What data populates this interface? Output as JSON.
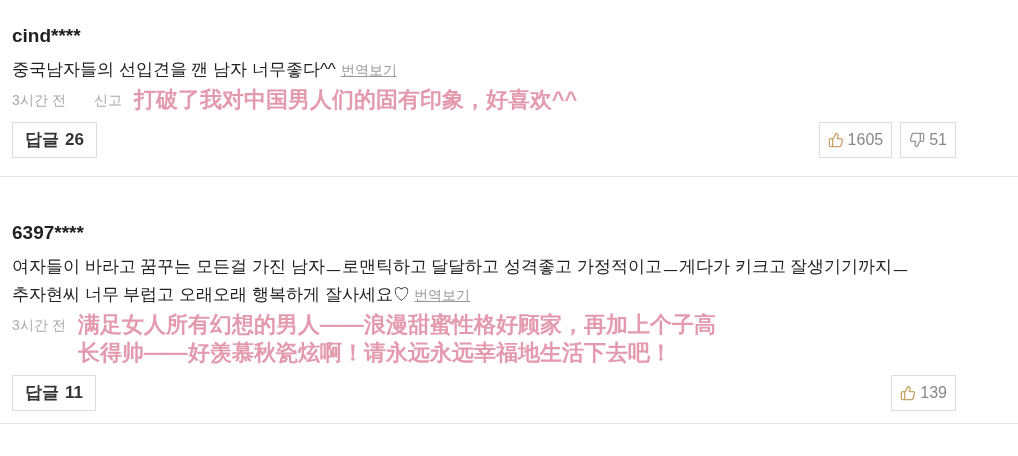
{
  "comments": [
    {
      "username": "cind****",
      "body": "중국남자들의 선입견을 깬 남자 너무좋다^^",
      "translate_link": "번역보기",
      "time": "3시간 전",
      "report": "신고",
      "translation": [
        "打破了我对中国男人们的固有印象，好喜欢^^"
      ],
      "reply": {
        "label": "답글",
        "count": "26"
      },
      "likes": "1605",
      "dislikes": "51"
    },
    {
      "username": "6397****",
      "body": "여자들이 바라고 꿈꾸는 모든걸 가진 남자ㅡ로맨틱하고 달달하고 성격좋고 가정적이고ㅡ게다가 키크고 잘생기기까지ㅡ 추자현씨 너무 부럽고 오래오래 행복하게 잘사세요♡",
      "translate_link": "번역보기",
      "time": "3시간 전",
      "translation": [
        "满足女人所有幻想的男人——浪漫甜蜜性格好顾家，再加上个子高",
        "长得帅——好羡慕秋瓷炫啊！请永远永远幸福地生活下去吧！"
      ],
      "reply": {
        "label": "답글",
        "count": "11"
      },
      "likes": "139"
    }
  ]
}
